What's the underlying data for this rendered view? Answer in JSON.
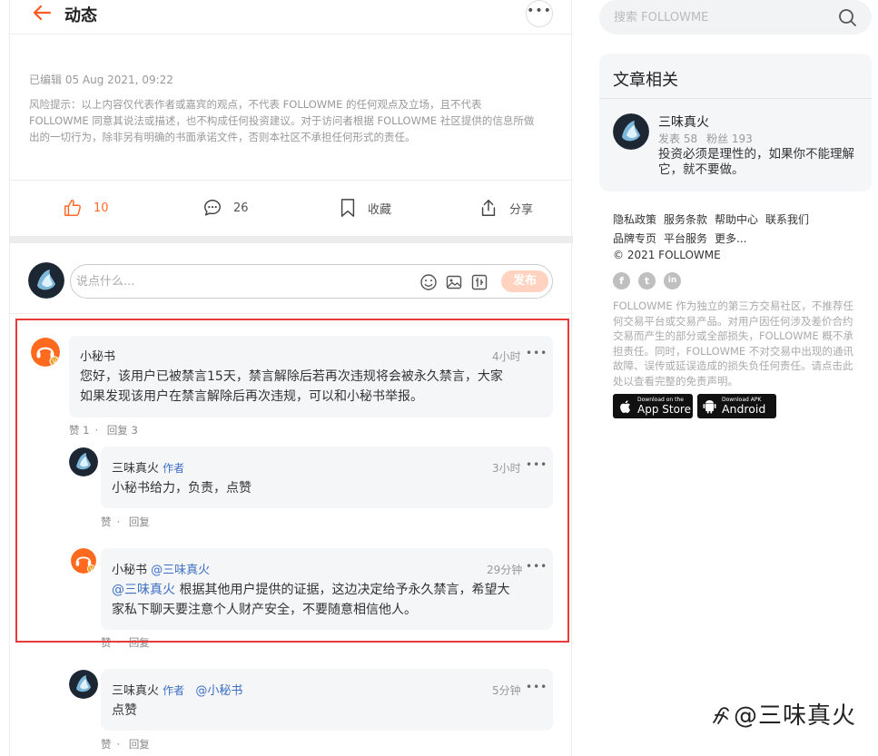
{
  "header": {
    "back_icon": "arrow-left-icon",
    "title": "动态",
    "more_icon": "more-horizontal-icon"
  },
  "post": {
    "edited": "已编辑 05 Aug 2021, 09:22",
    "risk_line1": "风险提示：以上内容仅代表作者或嘉宾的观点，不代表 FOLLOWME 的任何观点及立场，且不代表",
    "risk_line2": "FOLLOWME 同意其说法或描述，也不构成任何投资建议。对于访问者根据 FOLLOWME 社区提供的信息所做",
    "risk_line3": "出的一切行为，除非另有明确的书面承诺文件，否则本社区不承担任何形式的责任。"
  },
  "actions": {
    "like_count": "10",
    "comment_count": "26",
    "favorite_label": "收藏",
    "share_label": "分享",
    "accent": "#ff6a2b"
  },
  "composer": {
    "placeholder": "说点什么...",
    "send_label": "发布"
  },
  "comments": {
    "c1": {
      "name": "小秘书",
      "time": "4小时",
      "text1": "您好，该用户已被禁言15天，禁言解除后若再次违规将会被永久禁言，大家",
      "text2": "如果发现该用户在禁言解除后再次违规，可以和小秘书举报。",
      "like": "赞 1",
      "reply": "回复 3"
    },
    "c2": {
      "name": "三味真火",
      "tag": "作者",
      "time": "3小时",
      "text": "小秘书给力，负责，点赞",
      "like": "赞",
      "reply": "回复"
    },
    "c3": {
      "name": "小秘书",
      "mention": "@三味真火",
      "time": "29分钟",
      "text_mention": "@三味真火",
      "text1": " 根据其他用户提供的证据，这边决定给予永久禁言，希望大",
      "text2": "家私下聊天要注意个人财产安全，不要随意相信他人。",
      "like": "赞",
      "reply": "回复"
    },
    "c4": {
      "name": "三味真火",
      "tag": "作者",
      "mention": "@小秘书",
      "time": "5分钟",
      "text": "点赞",
      "like": "赞",
      "reply": "回复"
    }
  },
  "sidebar": {
    "search_placeholder": "搜索 FOLLOWME",
    "card_title": "文章相关",
    "author_name": "三味真火",
    "posts": "发表 58",
    "fans": "粉丝 193",
    "quote": "投资必须是理性的，如果你不能理解它，就不要做。",
    "links": [
      "隐私政策",
      "服务条款",
      "帮助中心",
      "联系我们",
      "品牌专页",
      "平台服务",
      "更多..."
    ],
    "copyright": "© 2021 FOLLOWME",
    "social": [
      "f",
      "t",
      "in"
    ],
    "disclaimer": "FOLLOWME 作为独立的第三方交易社区，不推荐任何交易平台或交易产品。对用户因任何涉及差价合约交易而产生的部分或全部损失，FOLLOWME 概不承担责任。同时，FOLLOWME 不对交易中出现的通讯故障、误传或延误造成的损失负任何责任。请点击此处以查看完整的免责声明。",
    "appstore_small": "Download on the",
    "appstore_big": "App Store",
    "android_small": "Download APK",
    "android_big": "Android"
  },
  "watermark": "@三味真火"
}
